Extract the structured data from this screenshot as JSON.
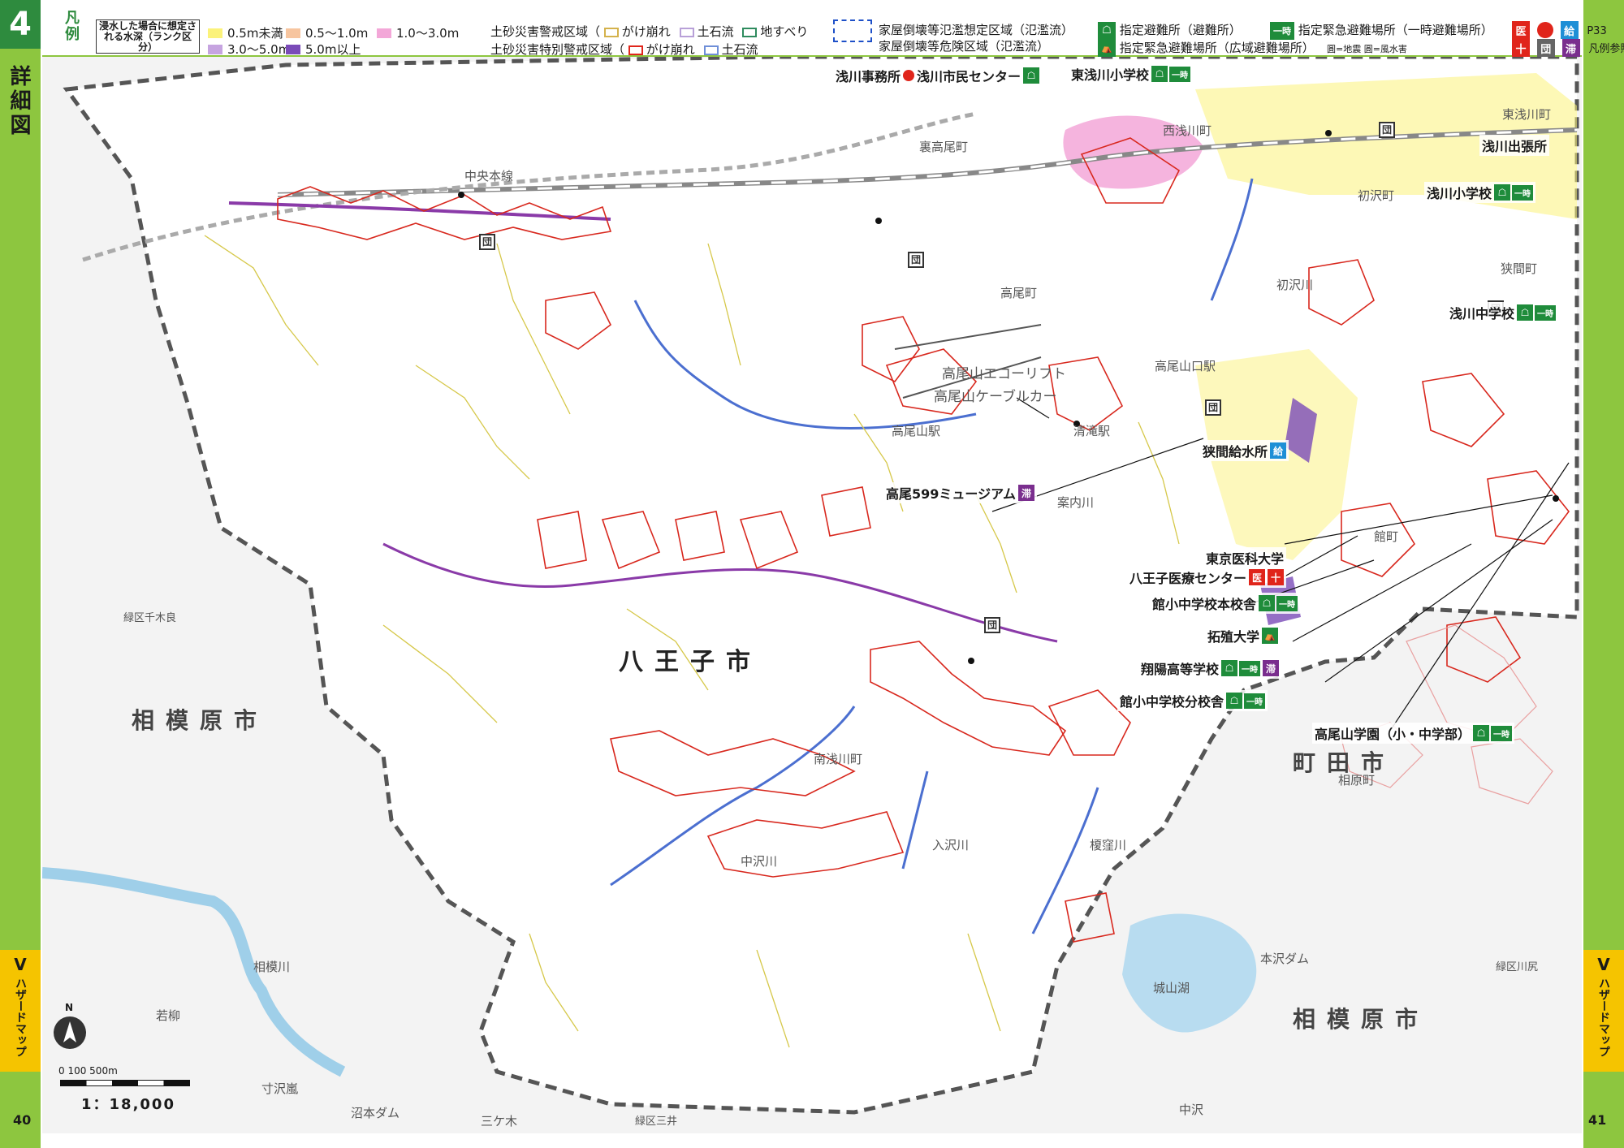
{
  "chapter": {
    "number": "4",
    "detail_label": "詳細図"
  },
  "side_tab": {
    "roman": "V",
    "text": "ハザードマップ"
  },
  "page_numbers": {
    "left": "40",
    "right": "41"
  },
  "legend": {
    "hanrei": "凡例",
    "depth_title": "浸水した場合に想定される水深（ランク区分）",
    "depth_ranks": [
      {
        "label": "0.5m未満",
        "color": "#fbf27a"
      },
      {
        "label": "0.5～1.0m",
        "color": "#f7c59f"
      },
      {
        "label": "1.0～3.0m",
        "color": "#f3a7d8"
      },
      {
        "label": "3.0～5.0m",
        "color": "#c6a4e0"
      },
      {
        "label": "5.0m以上",
        "color": "#7a4bb8"
      }
    ],
    "sediment_warning": "土砂災害警戒区域（",
    "sediment_special": "土砂災害特別警戒区域（",
    "cliff": "がけ崩れ",
    "debris_flow": "土石流",
    "landslide": "地すべり",
    "house_collapse_flood": "家屋倒壊等氾濫想定区域（氾濫流）",
    "house_collapse_danger": "家屋倒壊等危険区域（氾濫流）",
    "designated_shelter": "指定避難所（避難所）",
    "designated_emergency_temp": "指定緊急避難場所（一時避難場所）",
    "designated_emergency_wide": "指定緊急避難場所（広域避難場所）",
    "shelter_note": "圓=地震 圓=風水害",
    "ichiji": "一時",
    "hospital_icon": "医",
    "cross_icon": "十",
    "kyu_icon": "給",
    "dan_icon": "団",
    "tai_icon": "滞",
    "page_ref": "P33",
    "page_ref_note": "凡例参照",
    "colors": {
      "warning_outline": "#d4b24c",
      "special_outline": "#e0251b",
      "debris_outline": "#6f8fd8",
      "landslide_outline": "#2e8b5e"
    }
  },
  "map": {
    "city_hachioji": "八王子市",
    "city_sagamihara_left": "相模原市",
    "city_sagamihara_right": "相模原市",
    "city_machida": "町田市",
    "places": [
      "裏高尾町",
      "中央本線",
      "高尾町",
      "高尾山エコーリフト",
      "高尾山ケーブルカー",
      "高尾山駅",
      "清滝駅",
      "高尾山口駅",
      "西浅川町",
      "東浅川町",
      "初沢町",
      "狭間町",
      "初沢川",
      "案内川",
      "南浅川町",
      "中沢川",
      "入沢川",
      "榎窪川",
      "館町",
      "相原町",
      "本沢ダム",
      "城山湖",
      "緑区千木良",
      "緑区三井",
      "緑区川尻",
      "相模川",
      "若柳",
      "寸沢嵐",
      "沼本ダム",
      "三ケ木",
      "中沢"
    ],
    "callouts": {
      "asakawa_office": "浅川事務所",
      "asakawa_center": "浅川市民センター",
      "higashi_asakawa_es": "東浅川小学校",
      "asakawa_branch": "浅川出張所",
      "asakawa_es": "浅川小学校",
      "asakawa_jhs": "浅川中学校",
      "hazama_water": "狭間給水所",
      "takao599": "高尾599ミュージアム",
      "tokyo_med_1": "東京医科大学",
      "tokyo_med_2": "八王子医療センター",
      "tate_main": "館小中学校本校舎",
      "takushoku": "拓殖大学",
      "shoyo": "翔陽高等学校",
      "tate_branch": "館小中学校分校舎",
      "takaosan_gakuen": "高尾山学園（小・中学部）"
    }
  },
  "scale": {
    "north": "N",
    "nums": "0  100        500m",
    "ratio": "1：18,000"
  }
}
